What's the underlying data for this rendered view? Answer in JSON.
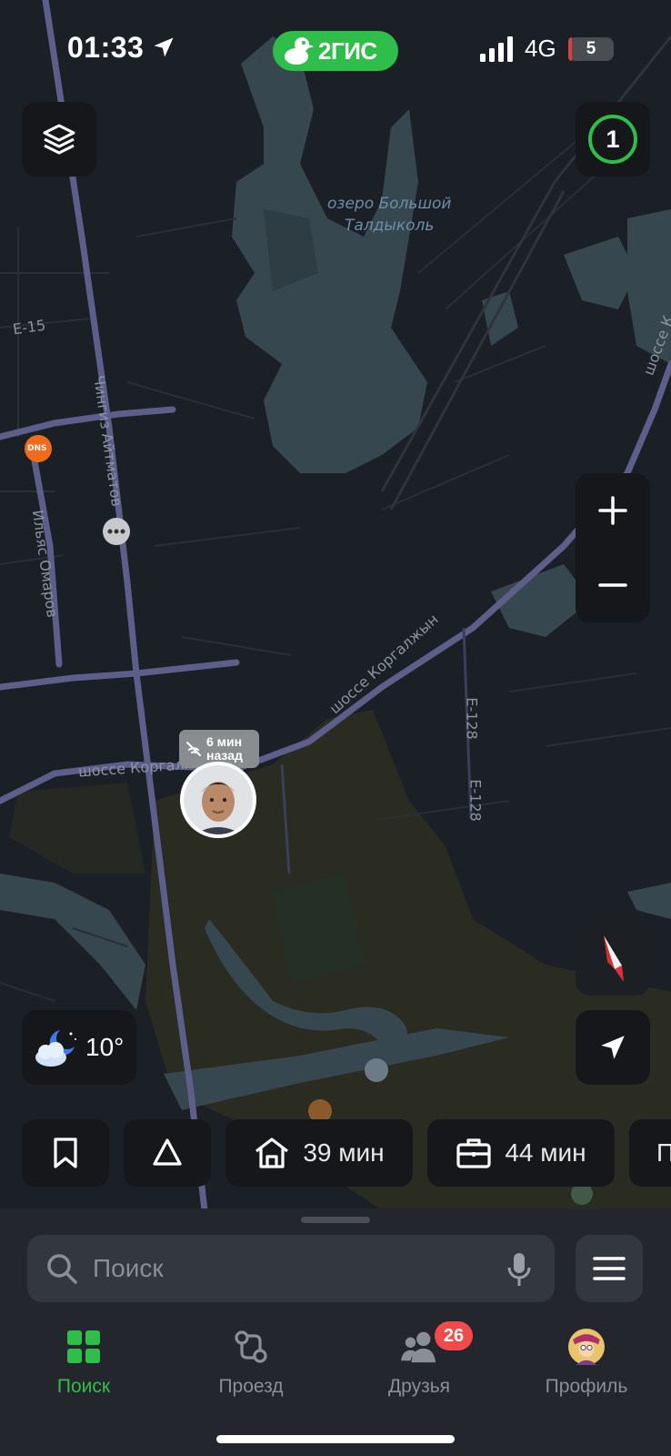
{
  "status_bar": {
    "time": "01:33",
    "app_badge": "2ГИС",
    "network": "4G",
    "battery": "5"
  },
  "map": {
    "lake_label": "озеро Большой\nТалдыколь",
    "roads": {
      "e15": "E-15",
      "aitmatov": "Чингиз Айтматов",
      "omarov": "Ильяс Омаров",
      "korgalzhyn_upper": "шоссе Коргалжын",
      "korgalzhyn_lower": "шоссе Коргалж",
      "e128_a": "E-128",
      "e128_b": "E-128",
      "right_edge": "шоссе К"
    },
    "dns_marker": "DNS",
    "friends_online": "1",
    "user_marker": {
      "time_ago": "6 мин\nназад"
    }
  },
  "weather": {
    "temp": "10°"
  },
  "shortcuts": {
    "home_time": "39 мин",
    "work_time": "44 мин",
    "more_label": "П"
  },
  "search": {
    "placeholder": "Поиск"
  },
  "tabs": {
    "search": "Поиск",
    "route": "Проезд",
    "friends": "Друзья",
    "friends_badge": "26",
    "profile": "Профиль"
  },
  "colors": {
    "accent": "#2fbe4a",
    "background": "#1b1f26",
    "water": "#37474f",
    "roads": "#5d5f8a",
    "forest": "#2a2c22",
    "badge": "#f04a4a"
  }
}
